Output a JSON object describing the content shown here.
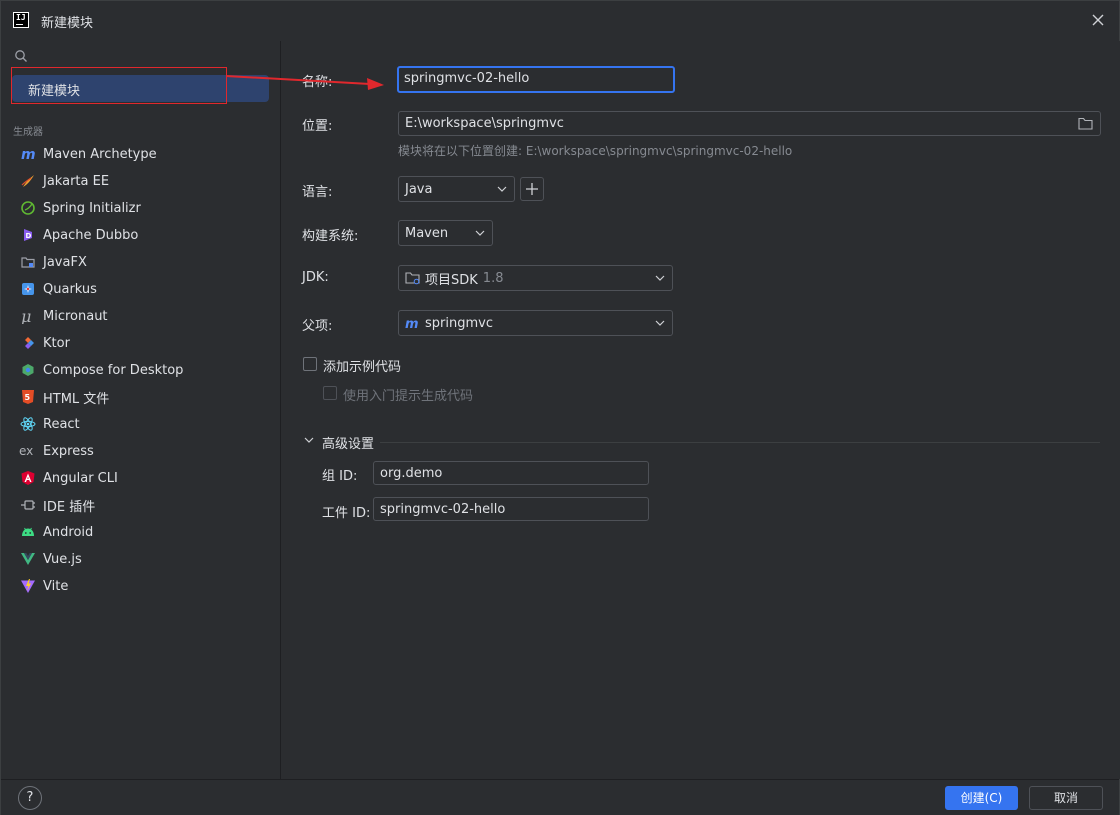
{
  "window": {
    "title": "新建模块"
  },
  "sidebar": {
    "selected_item": "新建模块",
    "section_title": "生成器",
    "generators": [
      {
        "label": "Maven Archetype",
        "icon": "maven-icon"
      },
      {
        "label": "Jakarta EE",
        "icon": "jakarta-icon"
      },
      {
        "label": "Spring Initializr",
        "icon": "spring-icon"
      },
      {
        "label": "Apache Dubbo",
        "icon": "dubbo-icon"
      },
      {
        "label": "JavaFX",
        "icon": "javafx-icon"
      },
      {
        "label": "Quarkus",
        "icon": "quarkus-icon"
      },
      {
        "label": "Micronaut",
        "icon": "micronaut-icon"
      },
      {
        "label": "Ktor",
        "icon": "ktor-icon"
      },
      {
        "label": "Compose for Desktop",
        "icon": "compose-icon"
      },
      {
        "label": "HTML 文件",
        "icon": "html-icon"
      },
      {
        "label": "React",
        "icon": "react-icon"
      },
      {
        "label": "Express",
        "icon": "express-icon"
      },
      {
        "label": "Angular CLI",
        "icon": "angular-icon"
      },
      {
        "label": "IDE 插件",
        "icon": "plugin-icon"
      },
      {
        "label": "Android",
        "icon": "android-icon"
      },
      {
        "label": "Vue.js",
        "icon": "vue-icon"
      },
      {
        "label": "Vite",
        "icon": "vite-icon"
      }
    ]
  },
  "form": {
    "name_label": "名称:",
    "name_value": "springmvc-02-hello",
    "location_label": "位置:",
    "location_value": "E:\\workspace\\springmvc",
    "location_hint": "模块将在以下位置创建: E:\\workspace\\springmvc\\springmvc-02-hello",
    "language_label": "语言:",
    "language_value": "Java",
    "build_label": "构建系统:",
    "build_value": "Maven",
    "jdk_label": "JDK:",
    "jdk_value": "项目SDK",
    "jdk_version": "1.8",
    "parent_label": "父项:",
    "parent_value": "springmvc",
    "sample_code_label": "添加示例代码",
    "onboarding_label": "使用入门提示生成代码",
    "advanced_label": "高级设置",
    "group_id_label": "组 ID:",
    "group_id_value": "org.demo",
    "artifact_id_label": "工件 ID:",
    "artifact_id_value": "springmvc-02-hello"
  },
  "footer": {
    "help_label": "?",
    "create_label": "创建(C)",
    "cancel_label": "取消"
  },
  "colors": {
    "accent": "#3574f0",
    "selection": "#2e436e",
    "annotation": "#e0282d"
  }
}
